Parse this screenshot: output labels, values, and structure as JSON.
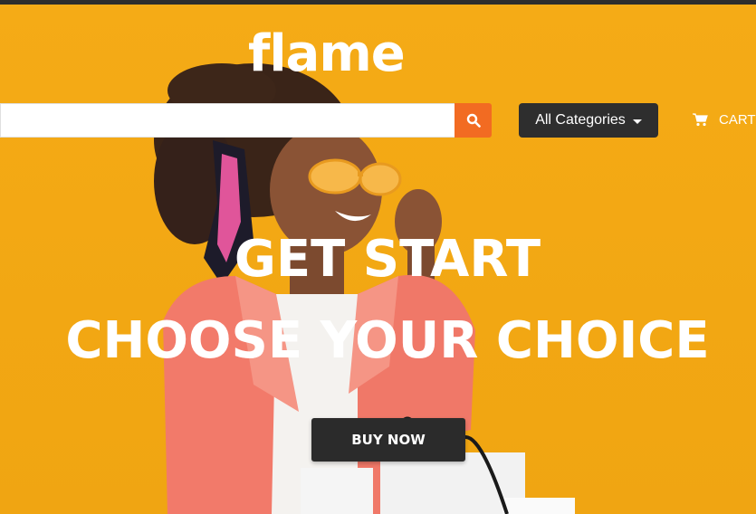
{
  "brand": {
    "logo_text": "flame"
  },
  "search": {
    "value": "",
    "placeholder": ""
  },
  "categories_button": {
    "label": "All Categories"
  },
  "cart": {
    "label": "CART"
  },
  "hero": {
    "headline_line1": "GET START",
    "headline_line2": "CHOOSE YOUR CHOICE",
    "cta_label": "BUY NOW"
  },
  "icons": {
    "search": "search-icon",
    "cart": "cart-icon",
    "dropdown": "chevron-down-icon"
  },
  "colors": {
    "background": "#f4a914",
    "accent": "#f26b22",
    "dark": "#2e2e2e",
    "text_light": "#ffffff"
  }
}
